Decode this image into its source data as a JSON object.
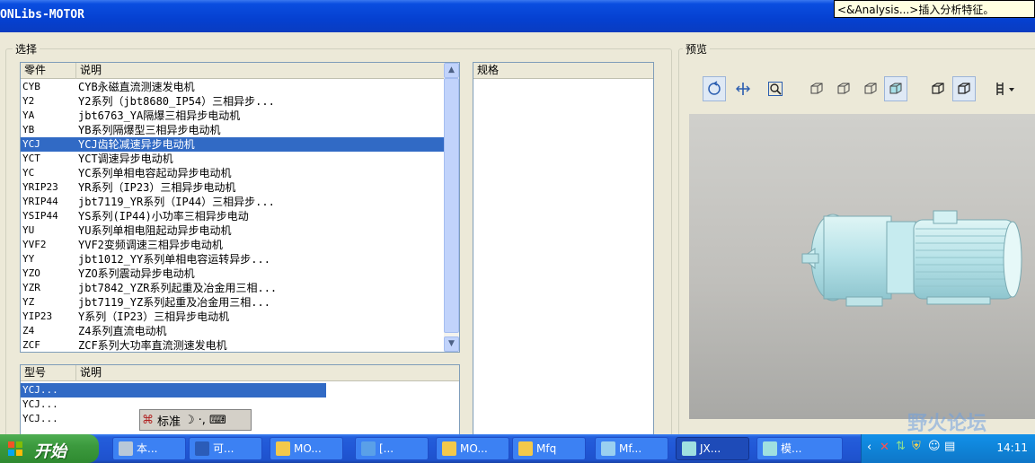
{
  "window": {
    "title": "ONLibs-MOTOR",
    "tooltip": "<&Analysis...>插入分析特征。"
  },
  "selection": {
    "group_label": "选择",
    "parts_list": {
      "col_part": "零件",
      "col_desc": "说明",
      "rows": [
        {
          "part": "CYB",
          "desc": "CYB永磁直流测速发电机"
        },
        {
          "part": "Y2",
          "desc": "Y2系列（jbt8680_IP54）三相异步..."
        },
        {
          "part": "YA",
          "desc": "jbt6763_YA隔爆三相异步电动机"
        },
        {
          "part": "YB",
          "desc": "YB系列隔爆型三相异步电动机"
        },
        {
          "part": "YCJ",
          "desc": "YCJ齿轮减速异步电动机"
        },
        {
          "part": "YCT",
          "desc": "YCT调速异步电动机"
        },
        {
          "part": "YC",
          "desc": "YC系列单相电容起动异步电动机"
        },
        {
          "part": "YRIP23",
          "desc": "YR系列（IP23）三相异步电动机"
        },
        {
          "part": "YRIP44",
          "desc": "jbt7119_YR系列（IP44）三相异步..."
        },
        {
          "part": "YSIP44",
          "desc": "YS系列(IP44)小功率三相异步电动"
        },
        {
          "part": "YU",
          "desc": "YU系列单相电阻起动异步电动机"
        },
        {
          "part": "YVF2",
          "desc": "YVF2变频调速三相异步电动机"
        },
        {
          "part": "YY",
          "desc": "jbt1012_YY系列单相电容运转异步..."
        },
        {
          "part": "YZO",
          "desc": "YZO系列震动异步电动机"
        },
        {
          "part": "YZR",
          "desc": "jbt7842_YZR系列起重及冶金用三相..."
        },
        {
          "part": "YZ",
          "desc": "jbt7119_YZ系列起重及冶金用三相..."
        },
        {
          "part": "YIP23",
          "desc": "Y系列（IP23）三相异步电动机"
        },
        {
          "part": "Z4",
          "desc": "Z4系列直流电动机"
        },
        {
          "part": "ZCF",
          "desc": "ZCF系列大功率直流测速发电机"
        }
      ],
      "selected_index": 4
    },
    "spec_header": "规格",
    "model_list": {
      "col_model": "型号",
      "col_desc": "说明",
      "rows": [
        {
          "model": "YCJ...",
          "desc": ""
        },
        {
          "model": "YCJ...",
          "desc": ""
        },
        {
          "model": "YCJ...",
          "desc": ""
        }
      ],
      "selected_index": 0
    }
  },
  "preview": {
    "group_label": "预览",
    "toolbar_icons": [
      "rotate-icon",
      "pan-icon",
      "zoom-icon",
      "view-front-icon",
      "view-left-icon",
      "view-top-icon",
      "shaded-icon",
      "wireframe-icon",
      "hidden-line-icon",
      "filter-menu-icon"
    ]
  },
  "ime": {
    "mode_label": "标准"
  },
  "taskbar": {
    "start_label": "开始",
    "tasks": [
      {
        "label": "本...",
        "icon": "drive-icon"
      },
      {
        "label": "可...",
        "icon": "word-icon"
      },
      {
        "label": "MO...",
        "icon": "folder-icon"
      },
      {
        "label": "[...",
        "icon": "app-icon"
      },
      {
        "label": "MO...",
        "icon": "folder-icon"
      },
      {
        "label": "Mfq",
        "icon": "folder-icon"
      },
      {
        "label": "Mf...",
        "icon": "file-icon"
      },
      {
        "label": "JX...",
        "icon": "proe-icon"
      },
      {
        "label": "模...",
        "icon": "proe-icon"
      }
    ],
    "clock": "14:11"
  },
  "watermark": "野火论坛"
}
